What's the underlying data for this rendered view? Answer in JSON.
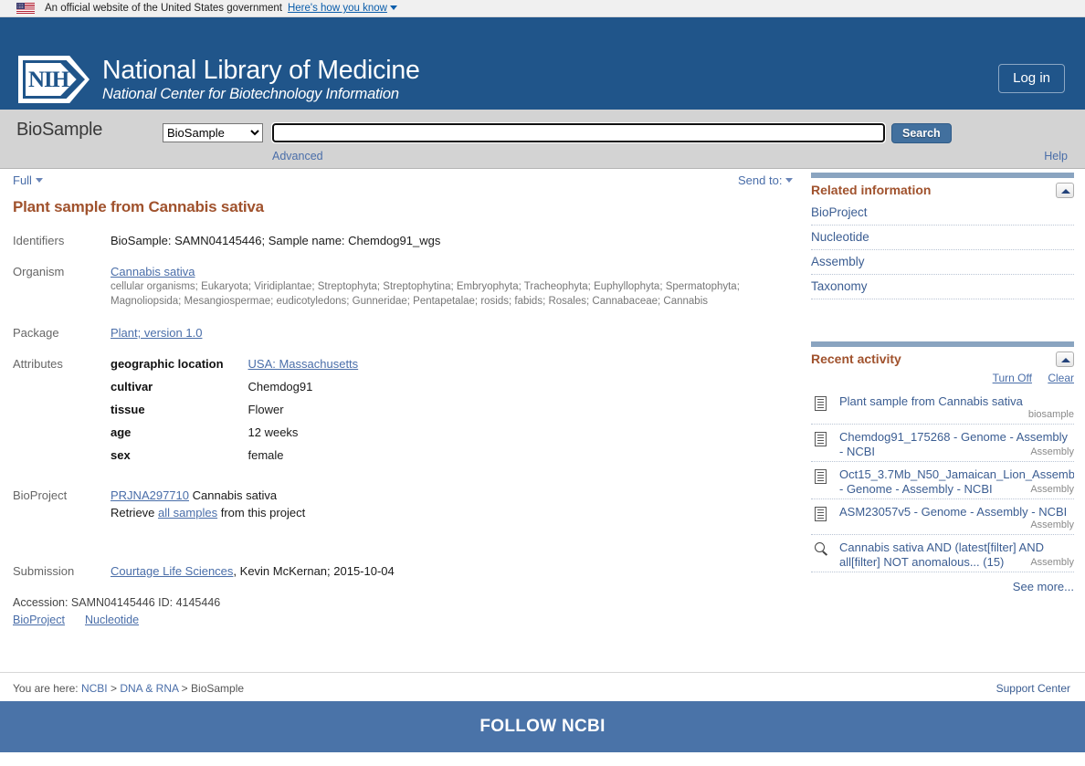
{
  "gov_banner": {
    "text": "An official website of the United States government",
    "how_you_know": "Here's how you know",
    "flag_icon": "us-flag-icon"
  },
  "header": {
    "logo_mark": "NIH",
    "line1": "National Library of Medicine",
    "line2": "National Center for Biotechnology Information",
    "login_label": "Log in"
  },
  "search": {
    "db_title": "BioSample",
    "selected_db": "BioSample",
    "db_options": [
      "BioSample"
    ],
    "input_value": "",
    "placeholder": "",
    "search_label": "Search",
    "advanced_label": "Advanced",
    "help_label": "Help"
  },
  "toolbar": {
    "display_mode": "Full",
    "send_to": "Send to:"
  },
  "record": {
    "title": "Plant sample from Cannabis sativa",
    "identifiers_label": "Identifiers",
    "identifiers_value": "BioSample: SAMN04145446; Sample name: Chemdog91_wgs",
    "organism_label": "Organism",
    "organism_name": "Cannabis sativa",
    "lineage": "cellular organisms; Eukaryota; Viridiplantae; Streptophyta; Streptophytina; Embryophyta; Tracheophyta; Euphyllophyta; Spermatophyta; Magnoliopsida; Mesangiospermae; eudicotyledons; Gunneridae; Pentapetalae; rosids; fabids; Rosales; Cannabaceae; Cannabis",
    "package_label": "Package",
    "package_value": "Plant; version 1.0",
    "attributes_label": "Attributes",
    "attributes": [
      {
        "key": "geographic location",
        "value": "USA: Massachusetts",
        "is_link": true
      },
      {
        "key": "cultivar",
        "value": "Chemdog91",
        "is_link": false
      },
      {
        "key": "tissue",
        "value": "Flower",
        "is_link": false
      },
      {
        "key": "age",
        "value": "12 weeks",
        "is_link": false
      },
      {
        "key": "sex",
        "value": "female",
        "is_link": false
      }
    ],
    "bioproject_label": "BioProject",
    "bioproject_accession": "PRJNA297710",
    "bioproject_organism": "Cannabis sativa",
    "retrieve_prefix": "Retrieve",
    "retrieve_link": "all samples",
    "retrieve_suffix": "from this project",
    "submission_label": "Submission",
    "submission_org": "Courtage Life Sciences",
    "submission_rest": ", Kevin McKernan; 2015-10-04",
    "accession_line": "Accession: SAMN04145446   ID: 4145446",
    "bottom_links": [
      "BioProject",
      "Nucleotide"
    ]
  },
  "sidebar": {
    "related": {
      "heading": "Related information",
      "collapse_icon": "collapse-up-icon",
      "items": [
        {
          "label": "BioProject"
        },
        {
          "label": "Nucleotide"
        },
        {
          "label": "Assembly"
        },
        {
          "label": "Taxonomy"
        }
      ]
    },
    "recent_activity": {
      "heading": "Recent activity",
      "collapse_icon": "collapse-up-icon",
      "turn_off": "Turn Off",
      "clear": "Clear",
      "items": [
        {
          "title": "Plant sample from Cannabis sativa",
          "db": "biosample",
          "icon": "document-icon",
          "wrap": false
        },
        {
          "title": "Chemdog91_175268 - Genome - Assembly - NCBI",
          "db": "Assembly",
          "icon": "document-icon",
          "wrap": true
        },
        {
          "title": "Oct15_3.7Mb_N50_Jamaican_Lion_Assemb - Genome - Assembly - NCBI",
          "db": "Assembly",
          "icon": "document-icon",
          "wrap": true
        },
        {
          "title": "ASM23057v5 - Genome - Assembly - NCBI",
          "db": "Assembly",
          "icon": "document-icon",
          "wrap": false
        },
        {
          "title": "Cannabis sativa AND (latest[filter] AND all[filter] NOT anomalous... (15)",
          "db": "Assembly",
          "icon": "search-icon",
          "wrap": true
        }
      ],
      "see_more": "See more..."
    }
  },
  "breadcrumb": {
    "prefix": "You are here:",
    "items": [
      "NCBI",
      "DNA & RNA",
      "BioSample"
    ],
    "separator": ">"
  },
  "footer": {
    "support_center": "Support Center",
    "follow_title": "FOLLOW NCBI"
  },
  "colors": {
    "nlm_blue": "#20558a",
    "title_brown": "#a0522d",
    "link_blue": "#4a6ea9",
    "footer_blue": "#4a73a8",
    "app_bar_gray": "#d3d3d3"
  }
}
